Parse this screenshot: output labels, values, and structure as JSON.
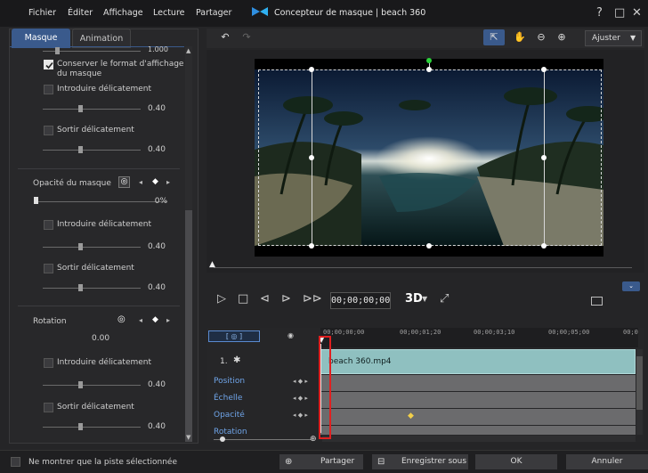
{
  "menu": {
    "items": [
      "Fichier",
      "Éditer",
      "Affichage",
      "Lecture",
      "Partager"
    ]
  },
  "window": {
    "title": "Concepteur de masque | beach 360",
    "help": "?",
    "restore": "□",
    "close": "✕"
  },
  "left_panel": {
    "tabs": [
      "Masque",
      "Animation"
    ],
    "top_value": "1.000",
    "keep_format_label": "Conserver le format d'affichage du masque",
    "fade_in_label": "Introduire délicatement",
    "fade_out_label": "Sortir délicatement",
    "val_040": "0.40",
    "opacity_label": "Opacité du masque",
    "opacity_value": "0%",
    "rotation_label": "Rotation",
    "rotation_value": "0.00"
  },
  "toolbar": {
    "fit_label": "Ajuster"
  },
  "player": {
    "timecode": "00;00;00;00",
    "mode_3d": "3D"
  },
  "timeline": {
    "ruler_ticks": [
      "00;00;00;00",
      "00;00;01;20",
      "00;00;03;10",
      "00;00;05;00",
      "00;0"
    ],
    "track_number": "1.",
    "clip_name": "beach 360.mp4",
    "rows": [
      "Position",
      "Échelle",
      "Opacité",
      "Rotation"
    ]
  },
  "bottom": {
    "only_selected_label": "Ne montrer que la piste sélectionnée",
    "share_label": "Partager",
    "save_as_label": "Enregistrer sous",
    "ok_label": "OK",
    "cancel_label": "Annuler"
  },
  "colors": {
    "accent": "#3a5a8c",
    "track_label": "#6fa4e8",
    "clip": "#8fc0c0",
    "keyframe": "#f2cf4a",
    "playhead": "#e02020"
  }
}
